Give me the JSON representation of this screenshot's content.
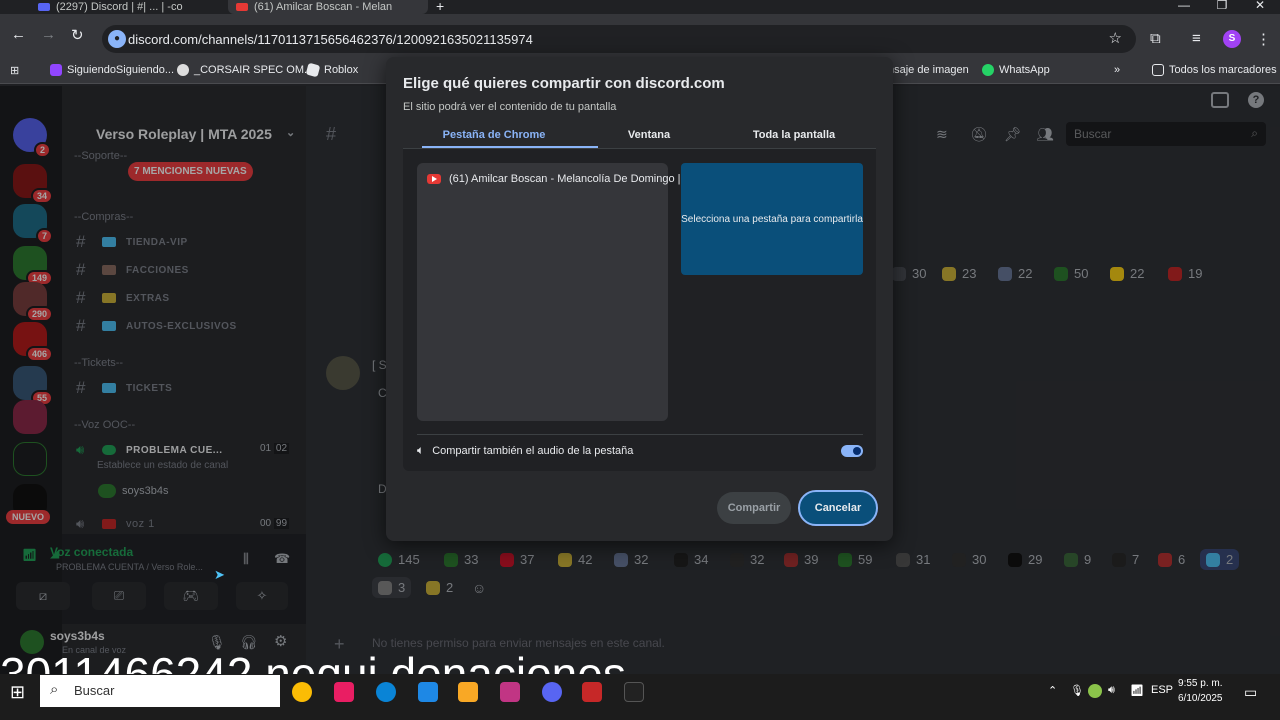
{
  "browser": {
    "tabs": [
      {
        "title": "(2297) Discord | #| ... | -co",
        "favicon": "discord"
      },
      {
        "title": "(61) Amilcar Boscan - Melan",
        "favicon": "youtube"
      }
    ],
    "new_tab": "+",
    "url": "discord.com/channels/1170113715656462376/1200921635021135974",
    "bookmarks": [
      "SiguiendoSiguiendo...",
      "_CORSAIR SPEC OM...",
      "Roblox",
      "nsaje de imagen",
      "WhatsApp"
    ],
    "all_bookmarks": "Todos los marcadores",
    "profile_initial": "S"
  },
  "discord": {
    "server_badges": [
      "34",
      "7",
      "149",
      "290",
      "406",
      "55"
    ],
    "new_badge": "NUEVO",
    "dm_badge": "2",
    "guild_name": "Verso Roleplay | MTA 2025",
    "mentions_banner": "7 MENCIONES NUEVAS",
    "categories": {
      "soporte": "--Soporte--",
      "compras": "--Compras--",
      "tickets": "--Tickets--",
      "voz": "--Voz OOC--"
    },
    "channels": [
      "TIENDA-VIP",
      "FACCIONES",
      "EXTRAS",
      "AUTOS-EXCLUSIVOS",
      "TICKETS"
    ],
    "voice_channel": {
      "name": "PROBLEMA CUE...",
      "count_a": "01",
      "count_b": "02",
      "status": "Establece un estado de canal",
      "member": "soys3b4s"
    },
    "voice_channel_2": {
      "name": "voz 1",
      "count_a": "00",
      "count_b": "99"
    },
    "voice_connected": {
      "title": "Voz conectada",
      "detail": "PROBLEMA CUENTA / Verso Role..."
    },
    "user": {
      "name": "soys3b4s",
      "status": "En canal de voz"
    },
    "search_placeholder": "Buscar",
    "top_reactions": [
      "30",
      "23",
      "22",
      "50",
      "22",
      "19"
    ],
    "bottom_reactions": [
      "145",
      "33",
      "37",
      "42",
      "32",
      "34",
      "32",
      "39",
      "59",
      "31",
      "30",
      "29",
      "9",
      "7",
      "6",
      "2"
    ],
    "bottom_reactions_2": [
      "3",
      "2"
    ],
    "message_placeholder": "No tienes permiso para enviar mensajes en este canal."
  },
  "share_dialog": {
    "title": "Elige qué quieres compartir con discord.com",
    "subtitle": "El sitio podrá ver el contenido de tu pantalla",
    "tabs": [
      "Pestaña de Chrome",
      "Ventana",
      "Toda la pantalla"
    ],
    "tab_item": "(61) Amilcar Boscan - Melancolía De Domingo |",
    "preview_text": "Selecciona una pestaña para compartirla",
    "audio_label": "Compartir también el audio de la pestaña",
    "audio_enabled": true,
    "share_button": "Compartir",
    "cancel_button": "Cancelar"
  },
  "overlay": {
    "text": "3011466242 nequi donaciones"
  },
  "taskbar": {
    "search": "Buscar",
    "language": "ESP",
    "time": "9:55 p. m.",
    "date": "6/10/2025"
  },
  "colors": {
    "accent": "#8ab4f8",
    "discord_bg": "#313338",
    "dialog_bg": "#28292c",
    "mention_red": "#f23f42"
  }
}
